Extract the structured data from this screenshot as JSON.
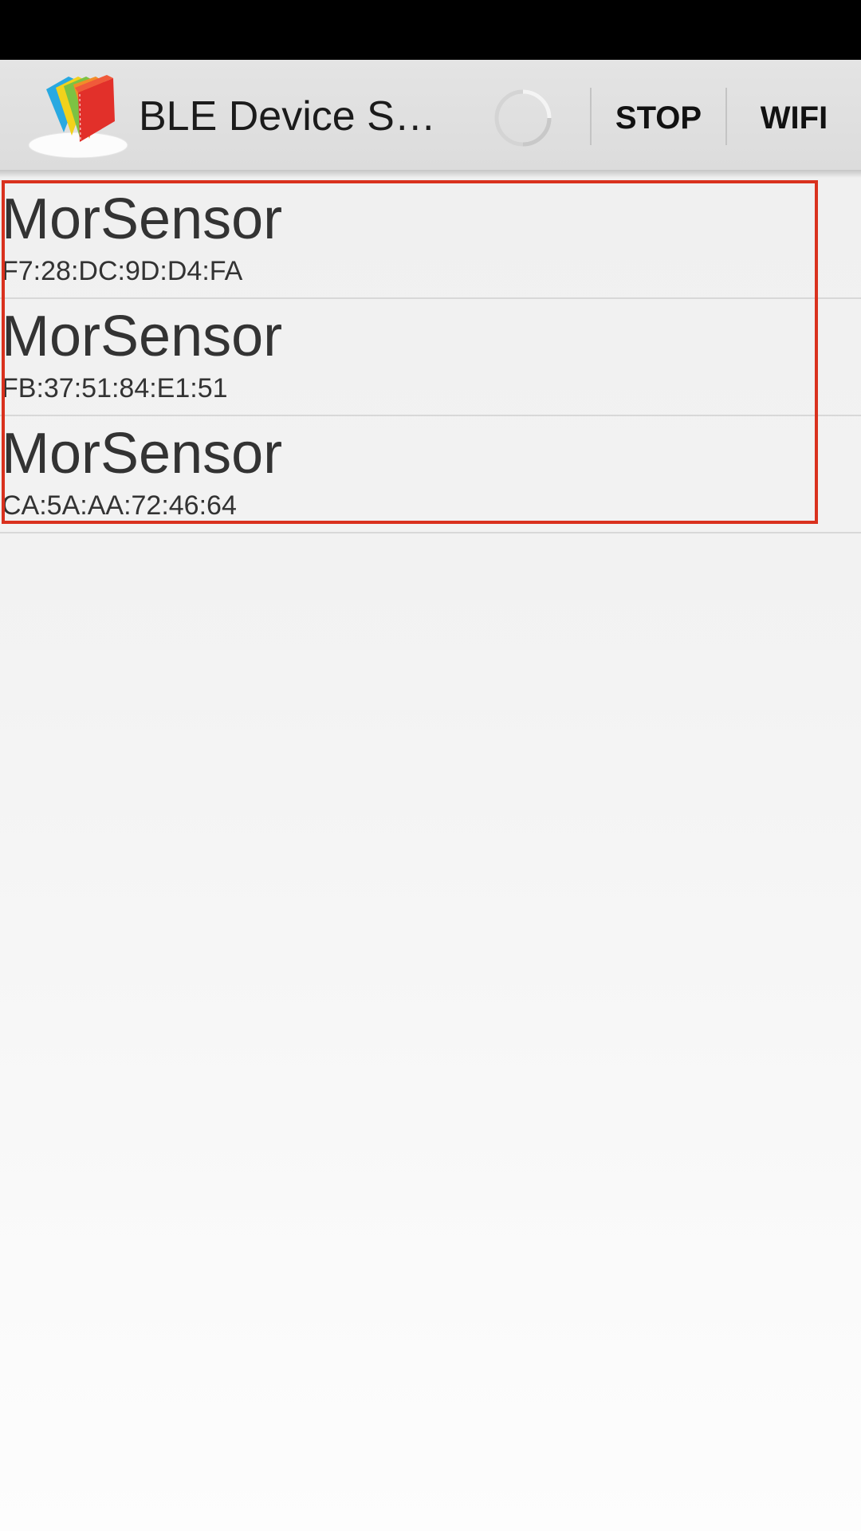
{
  "app": {
    "title": "BLE Device S…",
    "icon": "app-logo-icon"
  },
  "action_bar": {
    "spinner_icon": "loading-spinner-icon",
    "stop_label": "STOP",
    "wifi_label": "WIFI"
  },
  "devices": [
    {
      "name": "MorSensor",
      "address": "F7:28:DC:9D:D4:FA"
    },
    {
      "name": "MorSensor",
      "address": "FB:37:51:84:E1:51"
    },
    {
      "name": "MorSensor",
      "address": "CA:5A:AA:72:46:64"
    }
  ],
  "colors": {
    "highlight_border": "#d9311e",
    "status_bar": "#000000",
    "action_bar": "#e0e0e0",
    "text_primary": "#333333"
  }
}
